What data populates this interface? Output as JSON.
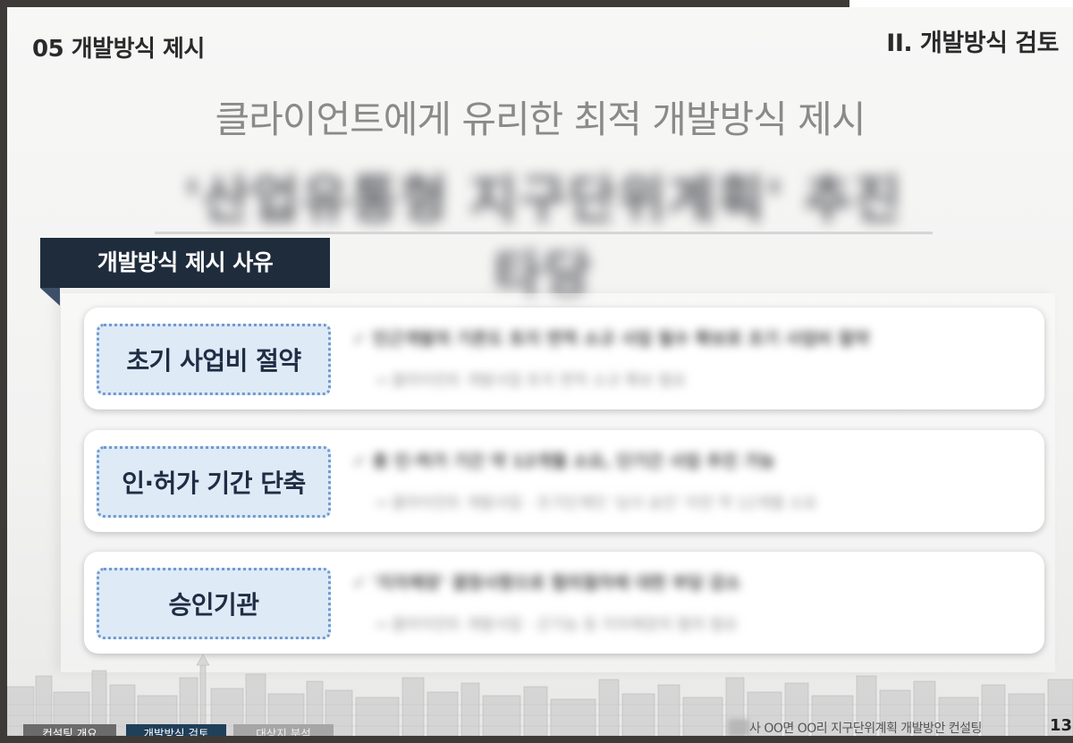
{
  "header": {
    "section_title": "05 개발방식 제시",
    "chapter_title": "II. 개발방식 검토"
  },
  "headline": "클라이언트에게 유리한 최적 개발방식 제시",
  "blurred_title": "'산업유통형 지구단위계획' 추진 타당",
  "reason_tab": "개발방식 제시 사유",
  "rows": [
    {
      "label": "초기 사업비 절약",
      "detail_line1": "✓ 인근개발의 기존도 토지 면적 소규 사업 필수 확보로 초기 사업비 절약",
      "detail_line2": "→ 클라이언트 개발사업 토지 면적 소규 확보 필요"
    },
    {
      "label": "인·허가 기간 단축",
      "detail_line1": "✓ 총 인·허가 기간 약 12개월 소요, 단기간 사업 추진 가능",
      "detail_line2": "→ 클라이언트 개발사업 · 조기단계인 '심사 승인' 이전 약 12개월 소요"
    },
    {
      "label": "승인기관",
      "detail_line1": "✓ '지자체장' 결정사항으로 협의절차에 대한 부담 감소",
      "detail_line2": "→ 클라이언트 개발사업 · 군기능 등 지자체장의 협의 필요"
    }
  ],
  "footer": {
    "tabs": [
      "컨설팅 개요",
      "개발방식 검토",
      "대상지 분석"
    ],
    "document_title": "사 OO면 OO리 지구단위계획 개발방안 컨설팅",
    "page_number": "13"
  }
}
